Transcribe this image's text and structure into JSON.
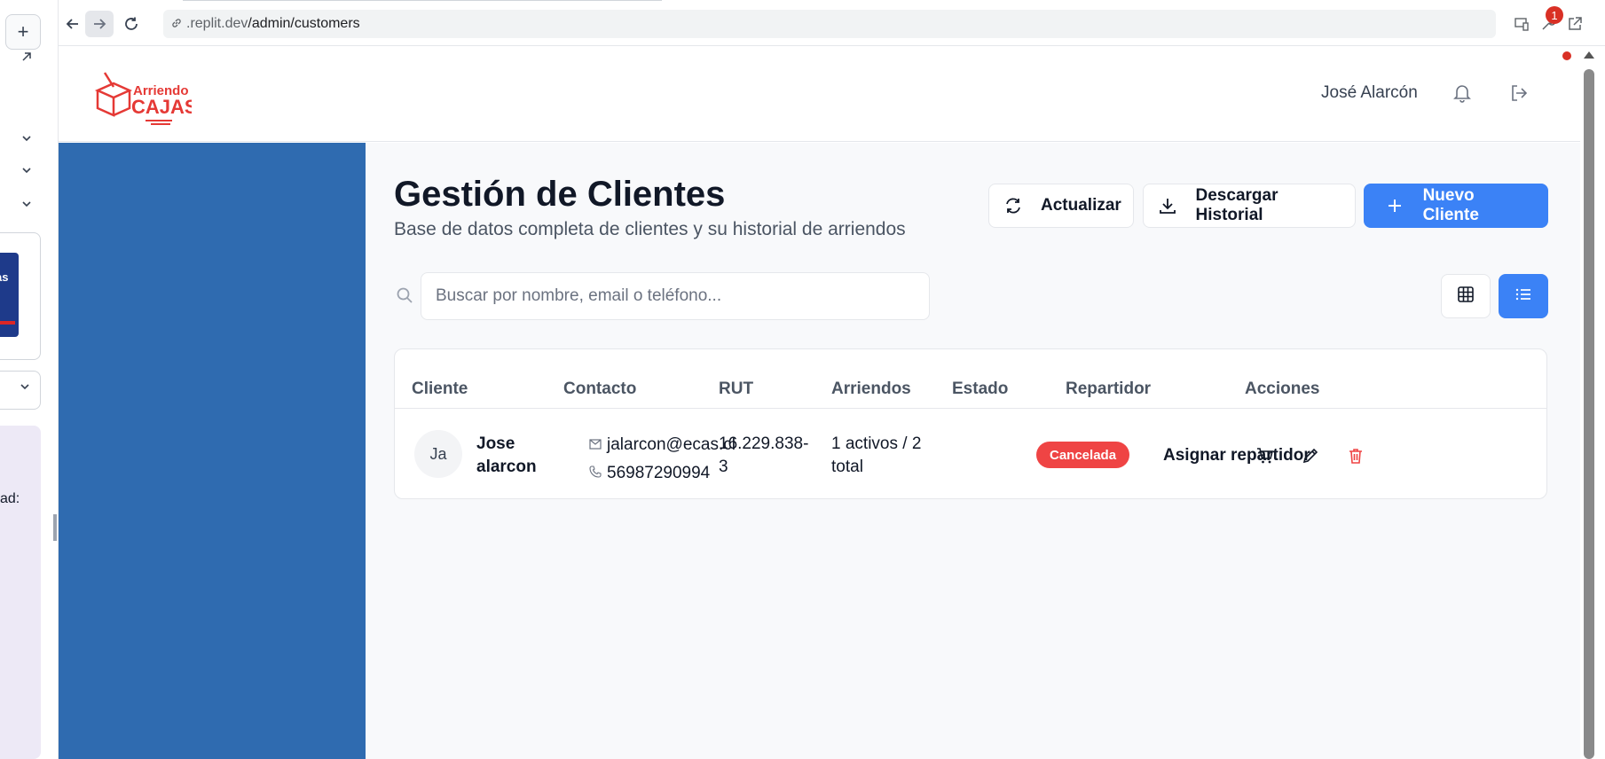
{
  "browser": {
    "url_host": ".replit.dev",
    "url_path": "/admin/customers",
    "notification_count": "1"
  },
  "left_panel": {
    "thumb_text": "as",
    "partial_label": "ad:"
  },
  "header": {
    "logo_line1": "Arriendo",
    "logo_line2": "CAJAS",
    "user_name": "José Alarcón"
  },
  "page": {
    "title": "Gestión de Clientes",
    "subtitle": "Base de datos completa de clientes y su historial de arriendos",
    "buttons": {
      "refresh": "Actualizar",
      "download": "Descargar Historial",
      "new_client": "Nuevo Cliente"
    },
    "search": {
      "placeholder": "Buscar por nombre, email o teléfono..."
    }
  },
  "table": {
    "columns": [
      "Cliente",
      "Contacto",
      "RUT",
      "Arriendos",
      "Estado",
      "Repartidor",
      "Acciones"
    ],
    "rows": [
      {
        "initials": "Ja",
        "name": "Jose alarcon",
        "email": "jalarcon@ecas.cl",
        "phone": "56987290994",
        "rut": "16.229.838-3",
        "rentals": "1 activos / 2 total",
        "status": "Cancelada",
        "assign": "Asignar repartidor"
      }
    ]
  },
  "colors": {
    "primary": "#3b82f6",
    "sidebar": "#2f6bb0",
    "danger": "#ef4444",
    "brand_red": "#e53935"
  }
}
